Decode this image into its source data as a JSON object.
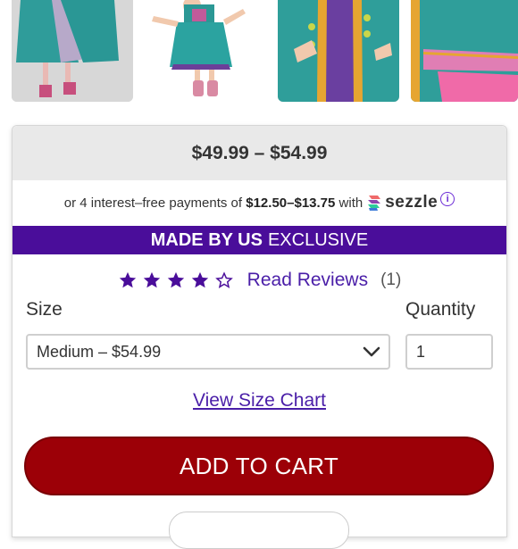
{
  "price": {
    "range": "$49.99 – $54.99"
  },
  "sezzle": {
    "prefix": "or 4 interest–free payments of",
    "amount": "$12.50–$13.75",
    "with": "with",
    "brand": "sezzle",
    "info_glyph": "i"
  },
  "banner": {
    "strong": "MADE BY US",
    "rest": "EXCLUSIVE"
  },
  "rating": {
    "stars": 4,
    "max": 5,
    "read_reviews": "Read Reviews",
    "count": "(1)"
  },
  "form": {
    "size_label": "Size",
    "quantity_label": "Quantity",
    "size_value": "Medium – $54.99",
    "quantity_value": "1"
  },
  "links": {
    "size_chart": "View Size Chart"
  },
  "buttons": {
    "add_to_cart": "ADD TO CART"
  },
  "colors": {
    "accent_purple": "#4a0d9a",
    "link_purple": "#4a1ea8",
    "cart_red": "#9c0007",
    "price_bg": "#e9e9e9"
  },
  "icons": [
    "star-filled-icon",
    "star-outline-icon",
    "sezzle-logo-icon",
    "info-icon",
    "chevron-down-icon"
  ]
}
